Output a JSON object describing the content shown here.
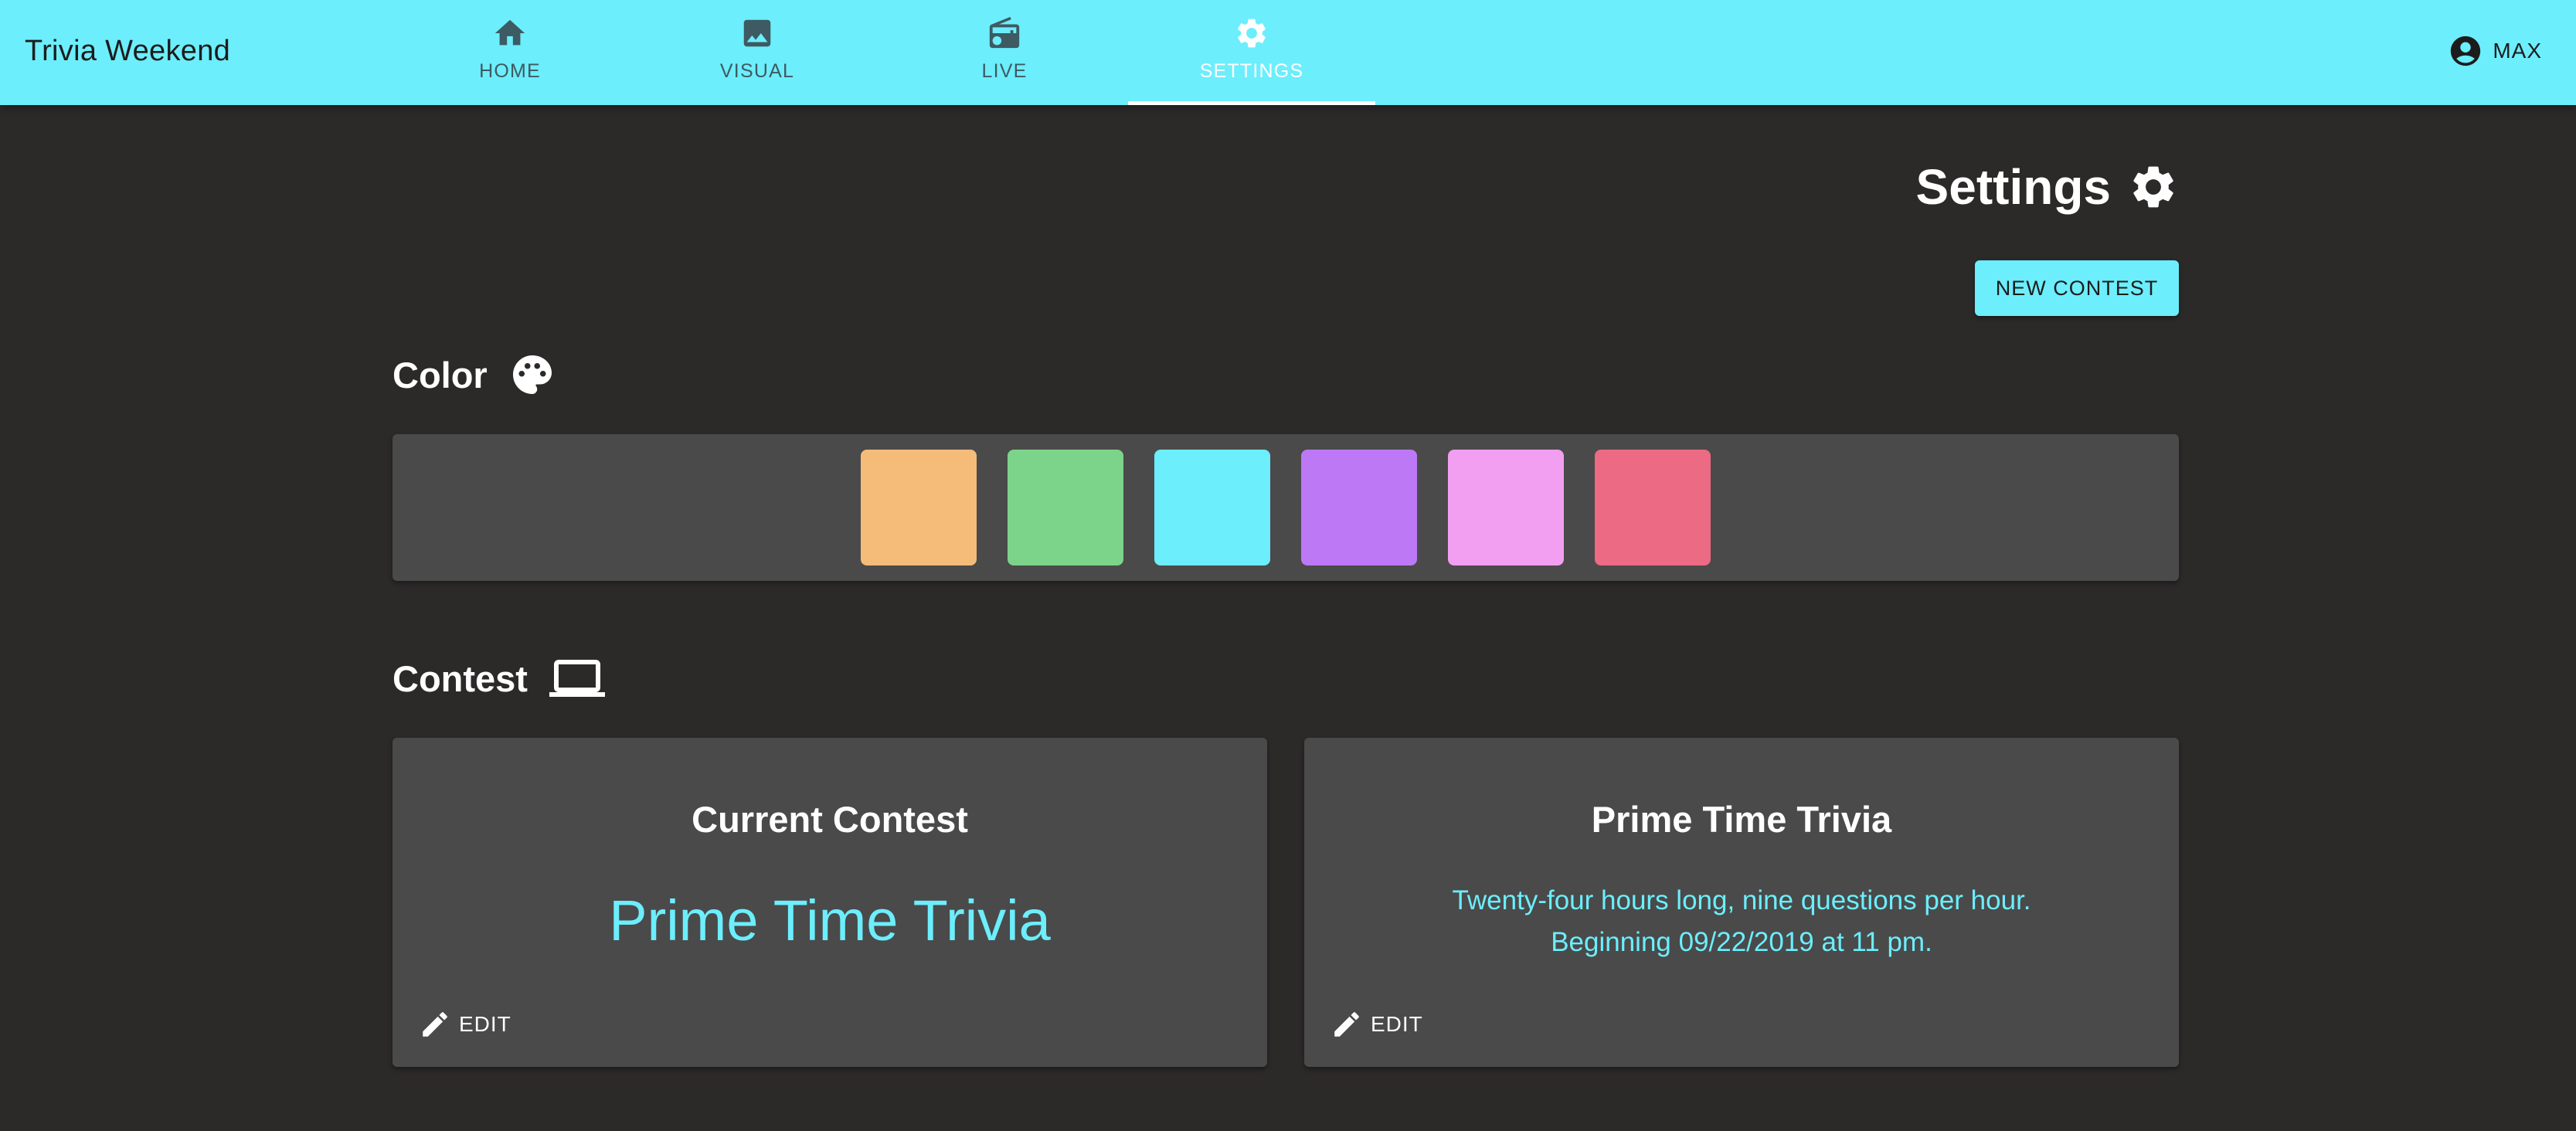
{
  "app": {
    "title": "Trivia Weekend"
  },
  "nav": {
    "tabs": [
      {
        "label": "HOME",
        "icon": "home-icon",
        "active": false
      },
      {
        "label": "VISUAL",
        "icon": "image-icon",
        "active": false
      },
      {
        "label": "LIVE",
        "icon": "radio-icon",
        "active": false
      },
      {
        "label": "SETTINGS",
        "icon": "gear-icon",
        "active": true
      }
    ]
  },
  "user": {
    "name": "MAX",
    "icon": "account-circle-icon"
  },
  "page": {
    "title": "Settings",
    "title_icon": "gear-icon"
  },
  "actions": {
    "new_contest": "NEW CONTEST"
  },
  "color_section": {
    "title": "Color",
    "icon": "palette-icon",
    "swatches": [
      "#f5bc79",
      "#7cd48b",
      "#6ceefc",
      "#bd78f6",
      "#f29ef1",
      "#ec6a83"
    ]
  },
  "contest_section": {
    "title": "Contest",
    "icon": "laptop-icon",
    "cards": [
      {
        "title": "Current Contest",
        "highlight": "Prime Time Trivia",
        "edit_label": "EDIT"
      },
      {
        "title": "Prime Time Trivia",
        "description_lines": [
          "Twenty-four hours long, nine questions per hour.",
          "Beginning 09/22/2019 at 11 pm."
        ],
        "edit_label": "EDIT"
      }
    ]
  },
  "colors": {
    "accent": "#6ceefc",
    "background": "#2c2929",
    "panel": "#4a4a4a"
  }
}
